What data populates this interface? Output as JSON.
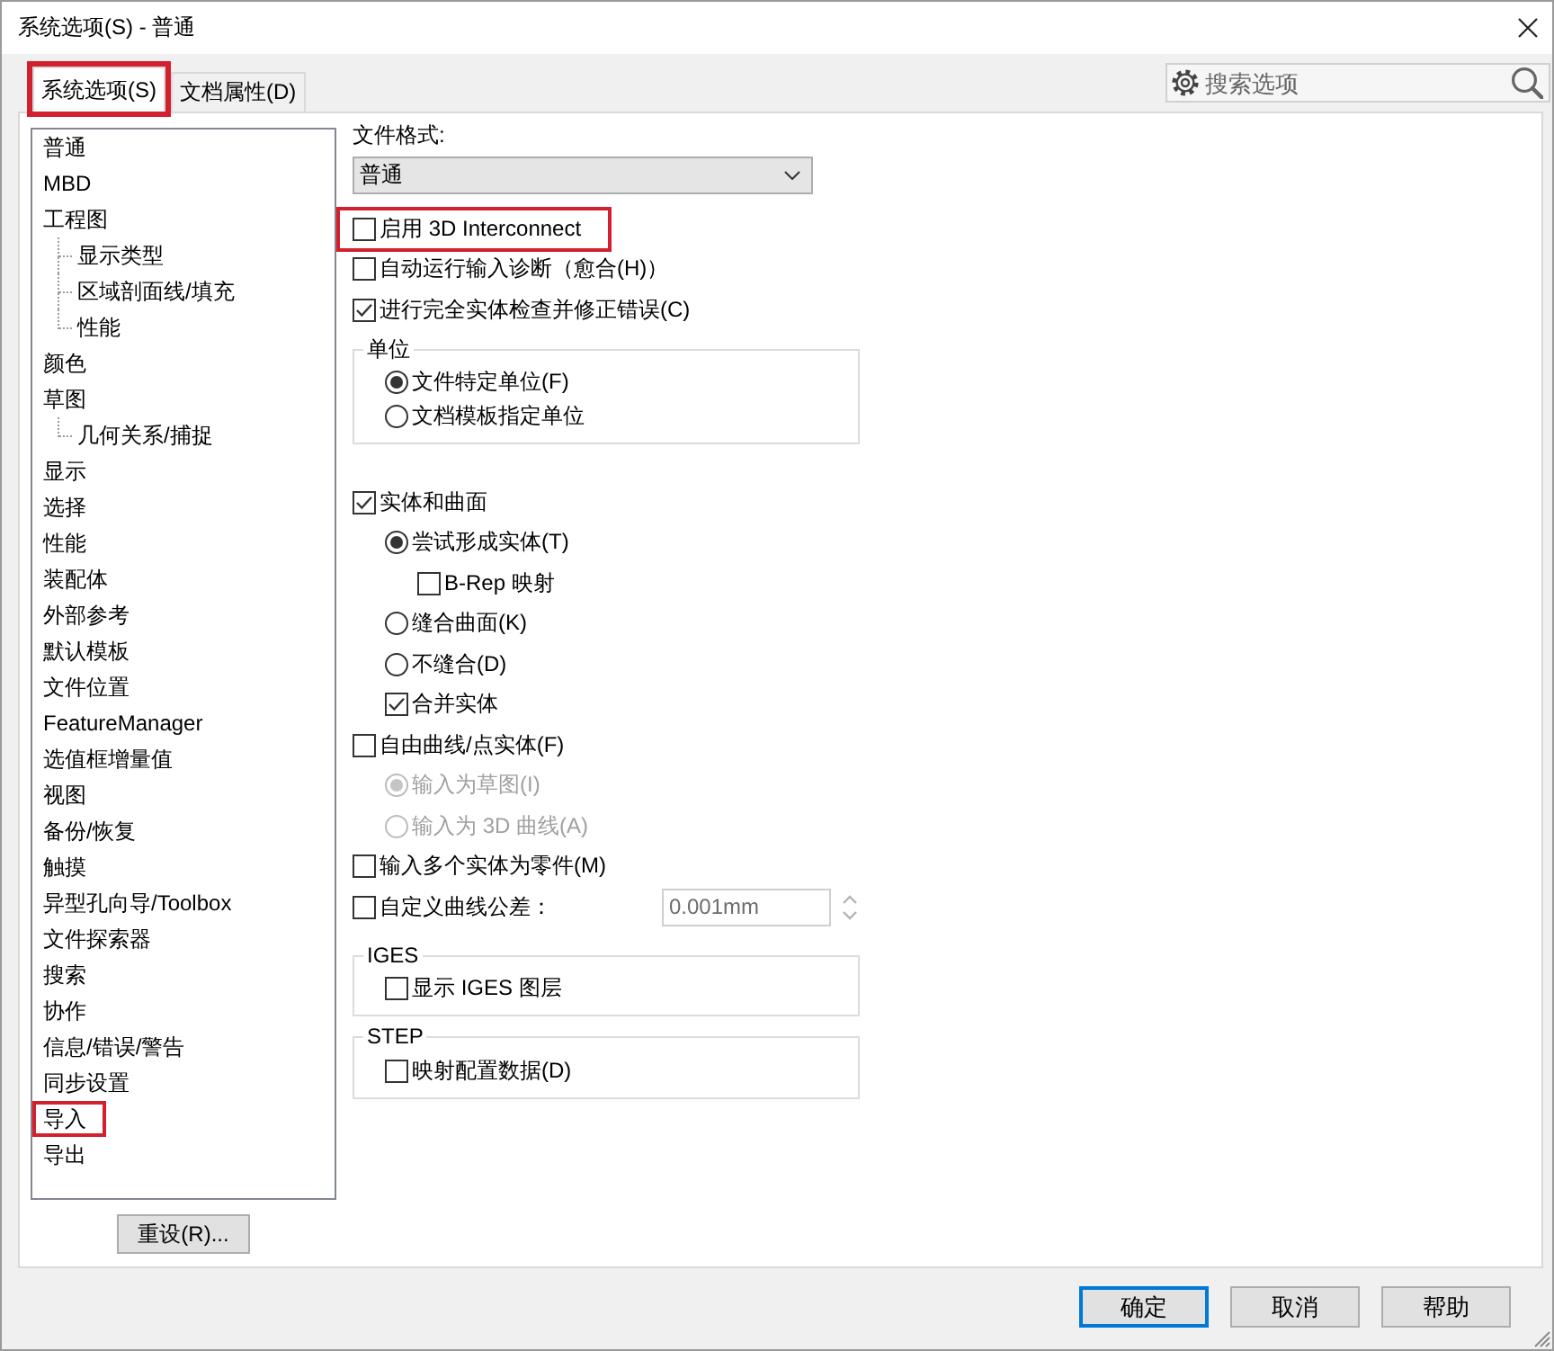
{
  "window": {
    "title": "系统选项(S) - 普通"
  },
  "tabs": [
    {
      "label": "系统选项(S)",
      "selected": true,
      "highlighted": true
    },
    {
      "label": "文档属性(D)",
      "selected": false,
      "highlighted": false
    }
  ],
  "search": {
    "placeholder": "搜索选项"
  },
  "sidebar": {
    "items": [
      {
        "label": "普通",
        "selected": false,
        "highlighted": false
      },
      {
        "label": "MBD",
        "selected": false,
        "highlighted": false
      },
      {
        "label": "工程图",
        "selected": false,
        "highlighted": false,
        "children": [
          {
            "label": "显示类型",
            "selected": false,
            "highlighted": false
          },
          {
            "label": "区域剖面线/填充",
            "selected": false,
            "highlighted": false
          },
          {
            "label": "性能",
            "selected": false,
            "highlighted": false
          }
        ]
      },
      {
        "label": "颜色",
        "selected": false,
        "highlighted": false
      },
      {
        "label": "草图",
        "selected": false,
        "highlighted": false,
        "children": [
          {
            "label": "几何关系/捕捉",
            "selected": false,
            "highlighted": false
          }
        ]
      },
      {
        "label": "显示",
        "selected": false,
        "highlighted": false
      },
      {
        "label": "选择",
        "selected": false,
        "highlighted": false
      },
      {
        "label": "性能",
        "selected": false,
        "highlighted": false
      },
      {
        "label": "装配体",
        "selected": false,
        "highlighted": false
      },
      {
        "label": "外部参考",
        "selected": false,
        "highlighted": false
      },
      {
        "label": "默认模板",
        "selected": false,
        "highlighted": false
      },
      {
        "label": "文件位置",
        "selected": false,
        "highlighted": false
      },
      {
        "label": "FeatureManager",
        "selected": false,
        "highlighted": false
      },
      {
        "label": "选值框增量值",
        "selected": false,
        "highlighted": false
      },
      {
        "label": "视图",
        "selected": false,
        "highlighted": false
      },
      {
        "label": "备份/恢复",
        "selected": false,
        "highlighted": false
      },
      {
        "label": "触摸",
        "selected": false,
        "highlighted": false
      },
      {
        "label": "异型孔向导/Toolbox",
        "selected": false,
        "highlighted": false
      },
      {
        "label": "文件探索器",
        "selected": false,
        "highlighted": false
      },
      {
        "label": "搜索",
        "selected": false,
        "highlighted": false
      },
      {
        "label": "协作",
        "selected": false,
        "highlighted": false
      },
      {
        "label": "信息/错误/警告",
        "selected": false,
        "highlighted": false
      },
      {
        "label": "同步设置",
        "selected": false,
        "highlighted": false
      },
      {
        "label": "导入",
        "selected": false,
        "highlighted": true
      },
      {
        "label": "导出",
        "selected": false,
        "highlighted": false
      }
    ],
    "reset_button": "重设(R)..."
  },
  "import_options": {
    "file_format": {
      "label": "文件格式:",
      "value": "普通"
    },
    "options": [
      {
        "kind": "checkbox",
        "label": "启用 3D Interconnect",
        "checked": false,
        "disabled": false,
        "highlighted": true
      },
      {
        "kind": "checkbox",
        "label": "自动运行输入诊断（愈合(H)）",
        "checked": false,
        "disabled": false,
        "highlighted": false
      },
      {
        "kind": "checkbox",
        "label": "进行完全实体检查并修正错误(C)",
        "checked": true,
        "disabled": false,
        "highlighted": false
      },
      {
        "kind": "group",
        "title": "单位",
        "disabled": false,
        "highlighted": false,
        "children": [
          {
            "kind": "radio",
            "label": "文件特定单位(F)",
            "selected": true,
            "disabled": false,
            "highlighted": false
          },
          {
            "kind": "radio",
            "label": "文档模板指定单位",
            "selected": false,
            "disabled": false,
            "highlighted": false
          }
        ]
      },
      {
        "kind": "checkbox",
        "label": "实体和曲面",
        "checked": true,
        "disabled": false,
        "highlighted": false,
        "children": [
          {
            "kind": "radio",
            "label": "尝试形成实体(T)",
            "selected": true,
            "disabled": false,
            "highlighted": false,
            "children": [
              {
                "kind": "checkbox",
                "label": "B-Rep 映射",
                "checked": false,
                "disabled": false,
                "highlighted": false
              }
            ]
          },
          {
            "kind": "radio",
            "label": "缝合曲面(K)",
            "selected": false,
            "disabled": false,
            "highlighted": false
          },
          {
            "kind": "radio",
            "label": "不缝合(D)",
            "selected": false,
            "disabled": false,
            "highlighted": false
          },
          {
            "kind": "checkbox",
            "label": "合并实体",
            "checked": true,
            "disabled": false,
            "highlighted": false
          }
        ]
      },
      {
        "kind": "checkbox",
        "label": "自由曲线/点实体(F)",
        "checked": false,
        "disabled": false,
        "highlighted": false,
        "children": [
          {
            "kind": "radio",
            "label": "输入为草图(I)",
            "selected": true,
            "disabled": true,
            "highlighted": false
          },
          {
            "kind": "radio",
            "label": "输入为 3D 曲线(A)",
            "selected": false,
            "disabled": true,
            "highlighted": false
          }
        ]
      },
      {
        "kind": "checkbox",
        "label": "输入多个实体为零件(M)",
        "checked": false,
        "disabled": false,
        "highlighted": false
      },
      {
        "kind": "checkbox",
        "label": "自定义曲线公差：",
        "checked": false,
        "disabled": false,
        "highlighted": false,
        "field": {
          "value": "0.001mm",
          "disabled": true
        }
      },
      {
        "kind": "group",
        "title": "IGES",
        "disabled": false,
        "highlighted": false,
        "children": [
          {
            "kind": "checkbox",
            "label": "显示 IGES 图层",
            "checked": false,
            "disabled": false,
            "highlighted": false
          }
        ]
      },
      {
        "kind": "group",
        "title": "STEP",
        "disabled": false,
        "highlighted": false,
        "children": [
          {
            "kind": "checkbox",
            "label": "映射配置数据(D)",
            "checked": false,
            "disabled": false,
            "highlighted": false
          }
        ]
      }
    ]
  },
  "buttons": [
    {
      "label": "确定",
      "default": true
    },
    {
      "label": "取消",
      "default": false
    },
    {
      "label": "帮助",
      "default": false
    }
  ]
}
